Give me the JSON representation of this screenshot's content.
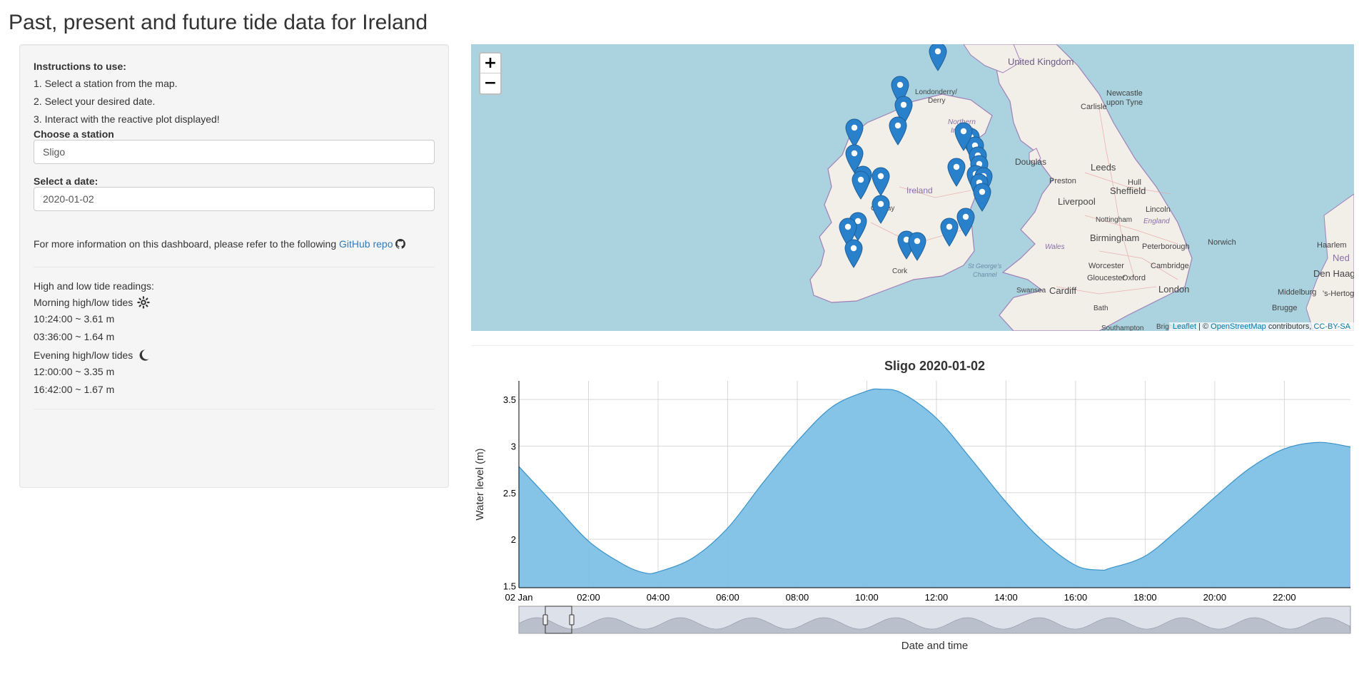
{
  "page": {
    "title": "Past, present and future tide data for Ireland"
  },
  "sidebar": {
    "instructions_title": "Instructions to use:",
    "steps": [
      "1. Select a station from the map.",
      "2. Select your desired date.",
      "3. Interact with the reactive plot displayed!"
    ],
    "station_label": "Choose a station",
    "station_value": "Sligo",
    "date_label": "Select a date:",
    "date_value": "2020-01-02",
    "info_text": "For more information on this dashboard, please refer to the following",
    "info_link": "GitHub repo",
    "info_icon": "github-icon"
  },
  "tides": {
    "heading": "High and low tide readings:",
    "morning_label": "Morning high/low tides",
    "morning_icon": "sun-icon",
    "morning": [
      "10:24:00 ~ 3.61 m",
      "03:36:00 ~ 1.64 m"
    ],
    "evening_label": "Evening high/low tides",
    "evening_icon": "moon-icon",
    "evening": [
      "12:00:00 ~ 3.35 m",
      "16:42:00 ~ 1.67 m"
    ]
  },
  "map": {
    "zoom_in": "+",
    "zoom_out": "−",
    "attribution": {
      "leaflet": "Leaflet",
      "sep": " | © ",
      "osm": "OpenStreetMap",
      "contrib": " contributors, ",
      "license": "CC-BY-SA"
    },
    "place_labels": [
      "United Kingdom",
      "Londonderry/",
      "Derry",
      "Northern",
      "Ireland",
      "Newcastle",
      "upon Tyne",
      "Carlisle",
      "Douglas",
      "Leeds",
      "Preston",
      "Hull",
      "Sheffield",
      "Ireland",
      "Galway",
      "Liverpool",
      "Lincoln",
      "Nottingham",
      "England",
      "Birmingham",
      "Wales",
      "Peterborough",
      "Norwich",
      "Cork",
      "St George's",
      "Channel",
      "Worcester",
      "Cambridge",
      "Gloucester",
      "Oxford",
      "Swansea",
      "Cardiff",
      "London",
      "Bath",
      "Southampton",
      "Brighton",
      "Haarlem",
      "Ned",
      "Den Haag",
      "Middelburg",
      "Brugge",
      "'s-Hertoge"
    ],
    "marker_icon": "map-pin-icon",
    "marker_count": 27
  },
  "chart_data": {
    "type": "area",
    "title": "Sligo 2020-01-02",
    "xlabel": "Date and time",
    "ylabel": "Water level (m)",
    "x_tick_labels": [
      "02 Jan",
      "02:00",
      "04:00",
      "06:00",
      "08:00",
      "10:00",
      "12:00",
      "14:00",
      "16:00",
      "18:00",
      "20:00",
      "22:00"
    ],
    "y_tick_labels": [
      "1.5",
      "2",
      "2.5",
      "3",
      "3.5"
    ],
    "ylim": [
      1.48,
      3.7
    ],
    "xlim_hours": [
      0,
      23.9
    ],
    "grid": true,
    "series": [
      {
        "x_hours": [
          0,
          1,
          2,
          3,
          3.6,
          4,
          5,
          6,
          7,
          8,
          9,
          10,
          10.4,
          11,
          12,
          13,
          14,
          15,
          16,
          16.7,
          17,
          18,
          19,
          20,
          21,
          22,
          23,
          23.9
        ],
        "y": [
          2.78,
          2.38,
          1.98,
          1.73,
          1.64,
          1.65,
          1.8,
          2.12,
          2.6,
          3.05,
          3.42,
          3.59,
          3.61,
          3.57,
          3.3,
          2.86,
          2.4,
          2.0,
          1.72,
          1.67,
          1.69,
          1.82,
          2.12,
          2.45,
          2.76,
          2.97,
          3.04,
          2.99
        ]
      }
    ],
    "range_selector": {
      "selected_start_hours": 0,
      "selected_end_hours": 24
    },
    "colors": {
      "fill": "#7fc1e6",
      "line": "#3a92c9"
    }
  }
}
